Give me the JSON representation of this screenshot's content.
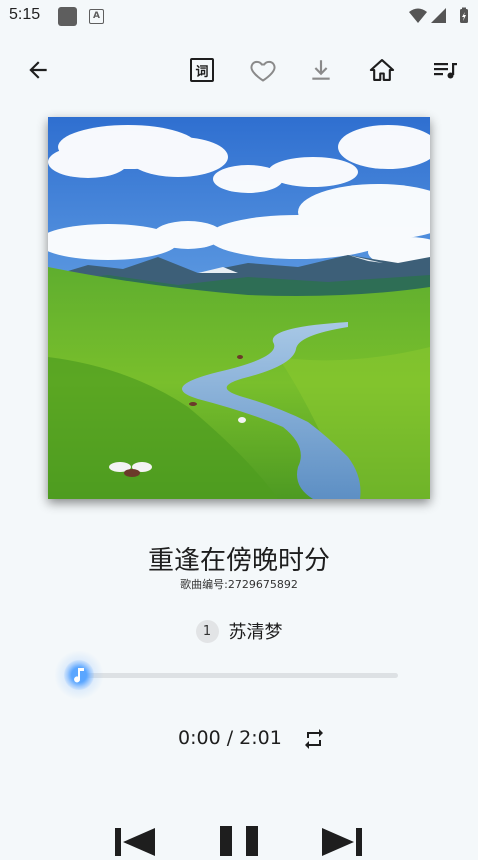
{
  "status_bar": {
    "time": "5:15",
    "a_badge": "A"
  },
  "toolbar": {
    "back_label": "back",
    "lyrics_label": "词"
  },
  "song": {
    "title": "重逢在傍晚时分",
    "id_text": "歌曲编号:2729675892"
  },
  "artist": {
    "index": "1",
    "name": "苏清梦"
  },
  "player": {
    "progress": 0,
    "time_display": "0:00 / 2:01"
  },
  "colors": {
    "accent": "#5aa6ff",
    "background": "#f4f8fa"
  }
}
